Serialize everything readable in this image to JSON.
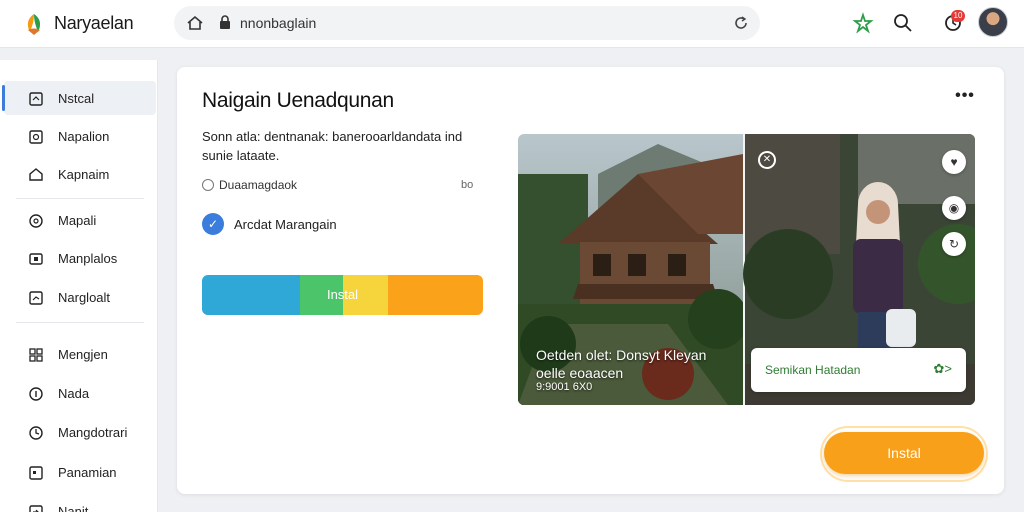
{
  "colors": {
    "accent": "#3b7ddd",
    "install": "#f8a01a",
    "progress_segments": [
      "#2fa8d8",
      "#4bc46a",
      "#f6d43b",
      "#f9a21a"
    ],
    "save_green": "#2e7d32"
  },
  "header": {
    "app_title": "Naryaelan",
    "url": "nnonbaglain",
    "icons": [
      "home-icon",
      "lock-icon",
      "reload-icon",
      "star-icon",
      "search-icon",
      "notifications-icon"
    ],
    "notification_count": "10"
  },
  "sidebar": {
    "items": [
      {
        "label": "Nstcal",
        "icon": "square-icon",
        "active": true
      },
      {
        "label": "Napalion",
        "icon": "image-icon"
      },
      {
        "label": "Kapnaim",
        "icon": "home-icon"
      },
      {
        "label": "Mapali",
        "icon": "compass-icon"
      },
      {
        "label": "Manplalos",
        "icon": "tablet-icon"
      },
      {
        "label": "Nargloalt",
        "icon": "chart-icon"
      },
      {
        "label": "Mengjen",
        "icon": "grid-icon"
      },
      {
        "label": "Nada",
        "icon": "info-icon"
      },
      {
        "label": "Mangdotrari",
        "icon": "clock-icon"
      },
      {
        "label": "Panamian",
        "icon": "square-icon"
      },
      {
        "label": "Nanit",
        "icon": "arrow-icon"
      }
    ]
  },
  "main": {
    "title": "Naigain Uenadqunan",
    "more_label": "•••",
    "description_line1": "Sonn atla: dentnanak: banerooarldandata ind",
    "description_line2": "sunie lataate.",
    "option_label": "Duaamagdaok",
    "option_meta": "bo",
    "check_label": "Arcdat Marangain",
    "progress_label": "Instal",
    "progress_fraction": 1.0,
    "install_label": "Instal"
  },
  "photo": {
    "caption_line1": "Oetden olet: Donsyt Kleyan",
    "caption_line2": "oelle eoaacen",
    "caption_line3": "9:9001 6X0",
    "save_label": "Semikan Hatadan",
    "save_arrow": "✿>"
  }
}
